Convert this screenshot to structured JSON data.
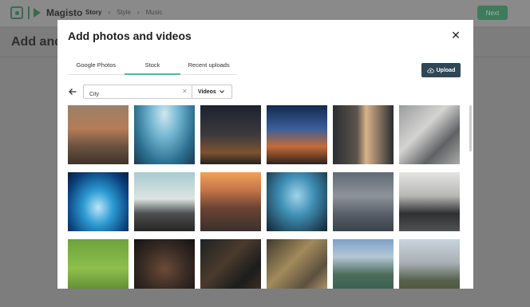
{
  "app": {
    "name": "Magisto",
    "steps": [
      "Story",
      "Style",
      "Music"
    ],
    "active_step": "Story",
    "next_label": "Next",
    "page_title": "Add and a"
  },
  "modal": {
    "title": "Add photos and videos",
    "close_icon": "close-icon",
    "tabs": [
      "Google Photos",
      "Stock",
      "Recent uploads"
    ],
    "active_tab": "Stock",
    "upload_label": "Upload",
    "search": {
      "value": "City",
      "placeholder": ""
    },
    "filter_selected": "Videos"
  },
  "colors": {
    "tab_indicator": "#55b6a0",
    "upload_button": "#2f4656",
    "next_button": "#3f7a5c"
  },
  "thumbnails": [
    "aerial-city-street",
    "skyscrapers-looking-up",
    "city-at-night",
    "city-skyline-dusk",
    "man-using-phone-night",
    "crosswalk-pedestrians",
    "blue-futuristic-tunnel",
    "cyclists-in-city",
    "city-sunset-aerial",
    "skyscrapers-blue-sky",
    "crowd-of-people",
    "feet-walking-city",
    "aerial-park-people",
    "aerial-night-street",
    "night-city-lights-aerial",
    "aerial-city-lights-gold",
    "city-waterfront-aerial",
    "suburban-aerial"
  ]
}
